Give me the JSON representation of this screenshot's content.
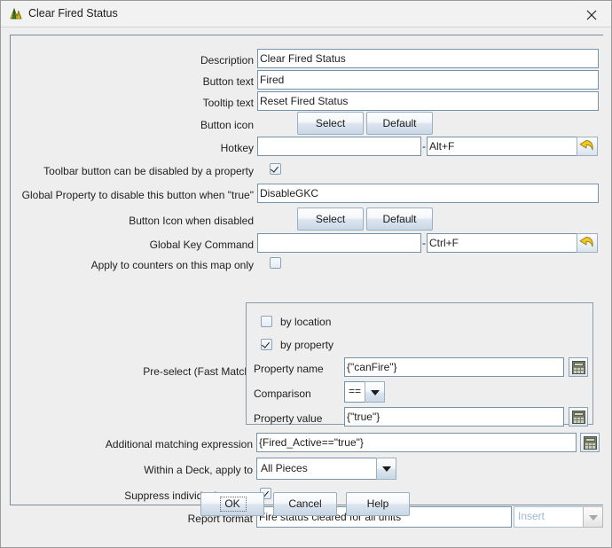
{
  "window": {
    "title": "Clear Fired Status",
    "app_icon": "vassal-logo-icon",
    "close_icon": "close-icon"
  },
  "form": {
    "description": {
      "label": "Description",
      "value": "Clear Fired Status"
    },
    "button_text": {
      "label": "Button text",
      "value": "Fired"
    },
    "tooltip_text": {
      "label": "Tooltip text",
      "value": "Reset Fired Status"
    },
    "button_icon": {
      "label": "Button icon",
      "select": "Select",
      "default": "Default"
    },
    "hotkey": {
      "label": "Hotkey",
      "name_value": "",
      "separator": "-",
      "key_value": "Alt+F",
      "undo_icon": "undo-arrow-icon"
    },
    "toolbar_disable": {
      "label": "Toolbar button can be disabled by a property",
      "checked": true
    },
    "global_property": {
      "label": "Global Property to disable this button when \"true\"",
      "value": "DisableGKC"
    },
    "disabled_icon": {
      "label": "Button Icon when disabled",
      "select": "Select",
      "default": "Default"
    },
    "global_key_command": {
      "label": "Global Key Command",
      "name_value": "",
      "separator": "-",
      "key_value": "Ctrl+F",
      "undo_icon": "undo-arrow-icon"
    },
    "this_map_only": {
      "label": "Apply to counters on this map only",
      "checked": false
    },
    "fast_match": {
      "label": "Pre-select (Fast Match)",
      "by_location": {
        "label": "by location",
        "checked": false
      },
      "by_property": {
        "label": "by property",
        "checked": true
      },
      "property_name": {
        "label": "Property name",
        "value": "{\"canFire\"}",
        "calc_icon": "calculator-icon"
      },
      "comparison": {
        "label": "Comparison",
        "value": "=="
      },
      "property_value": {
        "label": "Property value",
        "value": "{\"true\"}",
        "calc_icon": "calculator-icon"
      }
    },
    "additional_match": {
      "label": "Additional matching expression",
      "value": "{Fired_Active==\"true\"}",
      "calc_icon": "calculator-icon"
    },
    "deck_apply": {
      "label": "Within a Deck, apply to",
      "value": "All Pieces"
    },
    "suppress_reports": {
      "label": "Suppress individual reports",
      "checked": true
    },
    "report_format": {
      "label": "Report format",
      "value": "Fire status cleared for all units",
      "insert_placeholder": "Insert"
    }
  },
  "buttons": {
    "ok": "OK",
    "cancel": "Cancel",
    "help": "Help"
  },
  "colors": {
    "background": "#eeeeee",
    "field_border": "#7593a8",
    "panel_border": "#8c9aa8",
    "accent_yellow": "#e8c33b"
  }
}
